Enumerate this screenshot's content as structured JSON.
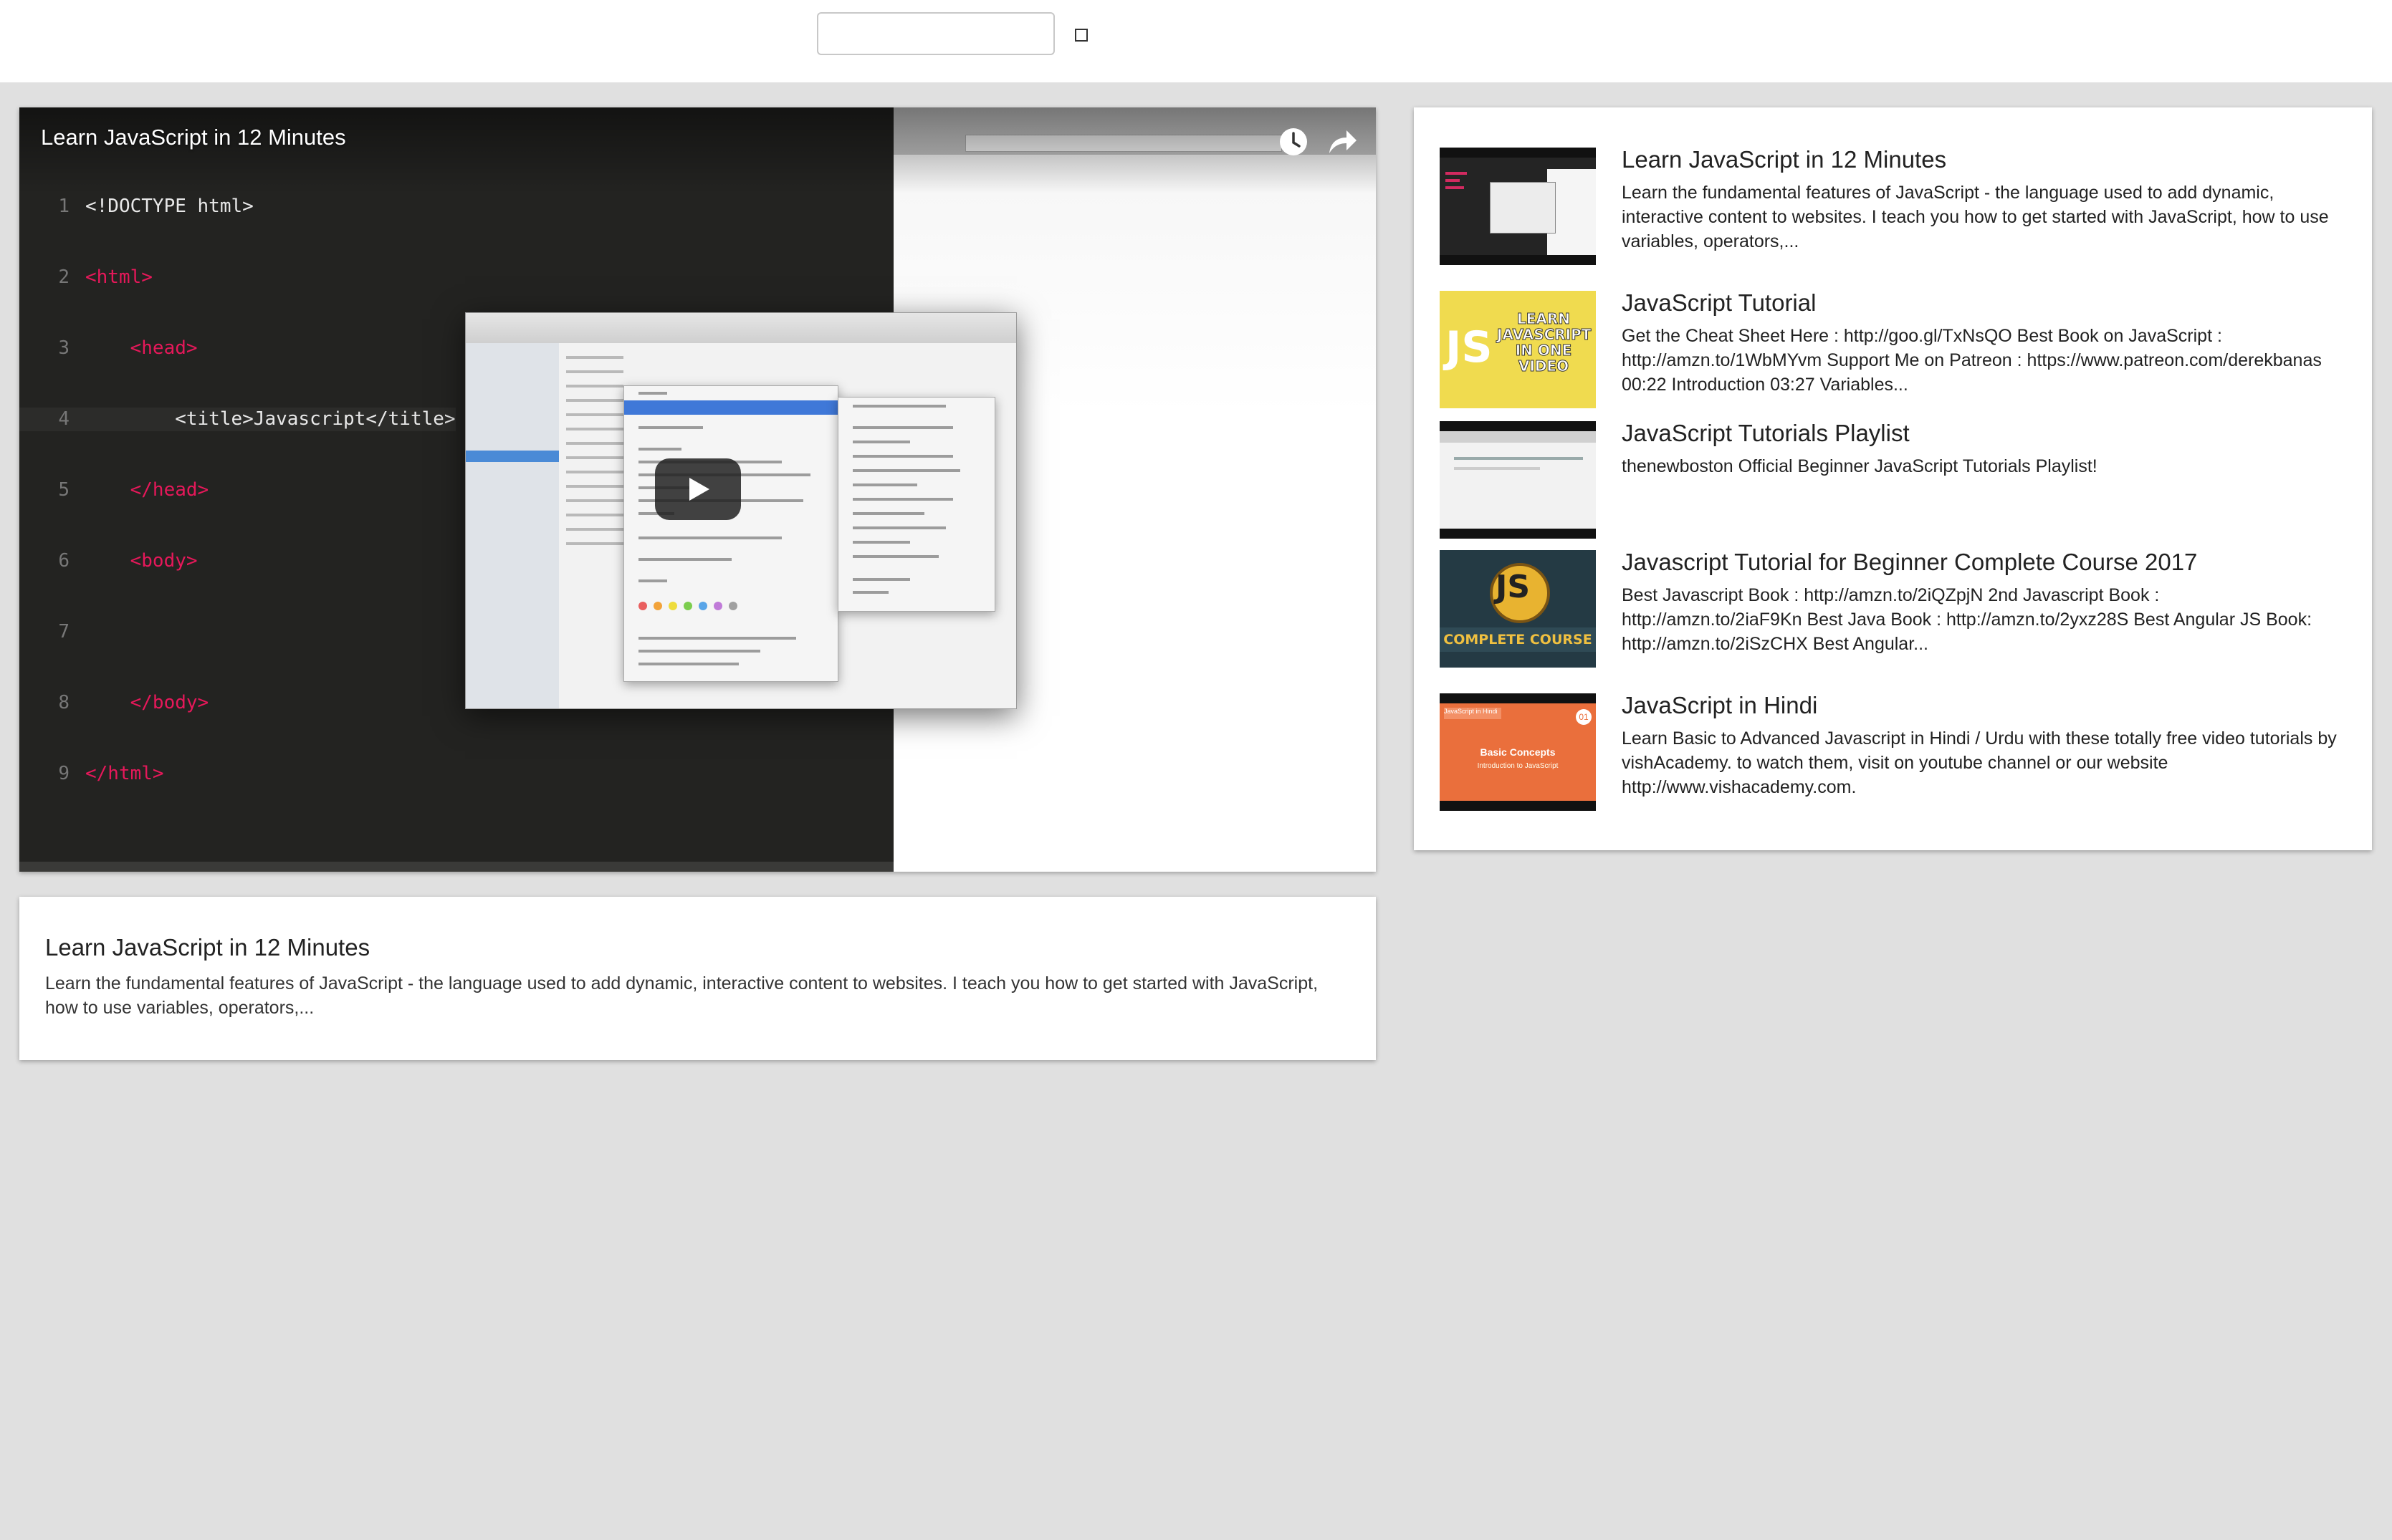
{
  "search": {
    "value": "",
    "placeholder": ""
  },
  "player": {
    "title": "Learn JavaScript in 12 Minutes",
    "code_lines": [
      {
        "n": "1",
        "text": "<!DOCTYPE html>"
      },
      {
        "n": "2",
        "text": "<html>"
      },
      {
        "n": "3",
        "text": "    <head>"
      },
      {
        "n": "4",
        "text": "        <title>Javascript</title>"
      },
      {
        "n": "5",
        "text": "    </head>"
      },
      {
        "n": "6",
        "text": "    <body>"
      },
      {
        "n": "7",
        "text": ""
      },
      {
        "n": "8",
        "text": "    </body>"
      },
      {
        "n": "9",
        "text": "</html>"
      }
    ],
    "icons": {
      "watch_later": "clock-icon",
      "share": "share-arrow-icon",
      "play": "play-icon"
    }
  },
  "selected_video": {
    "title": "Learn JavaScript in 12 Minutes",
    "description": "Learn the fundamental features of JavaScript - the language used to add dynamic, interactive content to websites. I teach you how to get started with JavaScript, how to use variables, operators,..."
  },
  "video_list": [
    {
      "title": "Learn JavaScript in 12 Minutes",
      "description": "Learn the fundamental features of JavaScript - the language used to add dynamic, interactive content to websites. I teach you how to get started with JavaScript, how to use variables, operators,..."
    },
    {
      "title": "JavaScript Tutorial",
      "description": "Get the Cheat Sheet Here : http://goo.gl/TxNsQO Best Book on JavaScript : http://amzn.to/1WbMYvm Support Me on Patreon : https://www.patreon.com/derekbanas 00:22 Introduction 03:27 Variables...",
      "thumb_js": "JS",
      "thumb_text": "LEARN JAVASCRIPT IN ONE VIDEO"
    },
    {
      "title": "JavaScript Tutorials Playlist",
      "description": "thenewboston Official Beginner JavaScript Tutorials Playlist!"
    },
    {
      "title": "Javascript Tutorial for Beginner Complete Course 2017",
      "description": "Best Javascript Book : http://amzn.to/2iQZpjN 2nd Javascript Book : http://amzn.to/2iaF9Kn Best Java Book : http://amzn.to/2yxz28S Best Angular JS Book: http://amzn.to/2iSzCHX Best Angular...",
      "thumb_js": "JS",
      "thumb_text": "COMPLETE COURSE"
    },
    {
      "title": "JavaScript in Hindi",
      "description": "Learn Basic to Advanced Javascript in Hindi / Urdu with these totally free video tutorials by vishAcademy. to watch them, visit on youtube channel or our website http://www.vishacademy.com.",
      "thumb_tag": "JavaScript in Hindi",
      "thumb_num": "01",
      "thumb_main": "Basic Concepts",
      "thumb_sub": "Introduction to JavaScript"
    }
  ],
  "colors": {
    "background": "#e0e0e0",
    "card": "#ffffff",
    "code_tag": "#e6185a"
  }
}
